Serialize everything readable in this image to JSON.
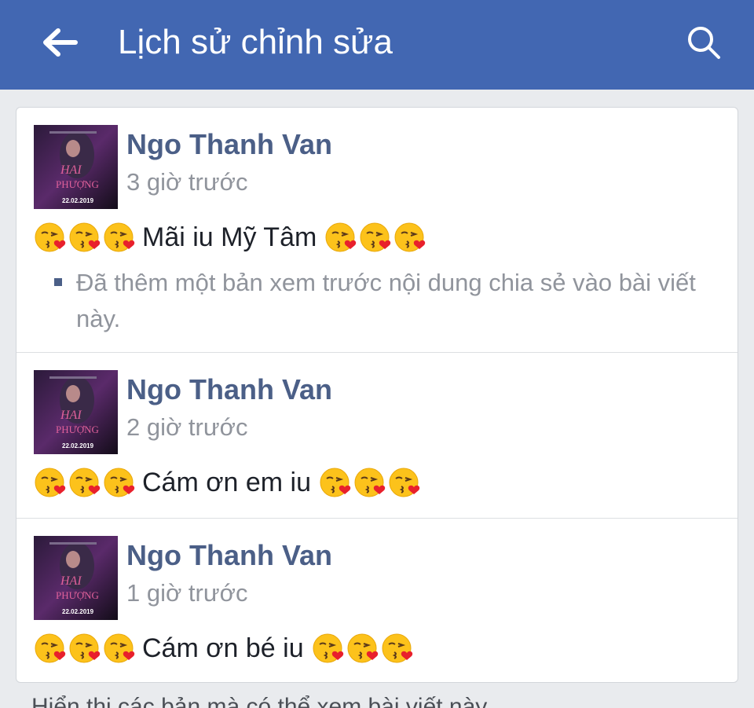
{
  "header": {
    "title": "Lịch sử chỉnh sửa",
    "back_icon": "arrow-left-icon",
    "search_icon": "search-icon",
    "background": "#4267b2"
  },
  "edits": [
    {
      "author": "Ngo Thanh Van",
      "time": "3 giờ trước",
      "text": "Mãi iu Mỹ Tâm",
      "note": "Đã thêm một bản xem trước nội dung chia sẻ vào bài viết này."
    },
    {
      "author": "Ngo Thanh Van",
      "time": "2 giờ trước",
      "text": "Cám ơn em iu"
    },
    {
      "author": "Ngo Thanh Van",
      "time": "1 giờ trước",
      "text": "Cám ơn bé iu"
    }
  ],
  "avatar_poster": {
    "title_line1": "HAI",
    "title_line2": "PHƯỢNG",
    "date": "22.02.2019"
  },
  "emoji": "face-blowing-kiss-icon",
  "footer": {
    "partial_text": "Hiển thị các bản mà có thể xem bài viết này"
  }
}
